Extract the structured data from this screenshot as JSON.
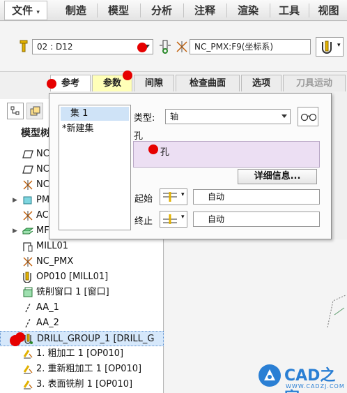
{
  "menu": {
    "items": [
      "文件",
      "制造",
      "模型",
      "分析",
      "注释",
      "渲染",
      "工具",
      "视图"
    ]
  },
  "toolbar": {
    "tool_value": "02 : D12",
    "coord_value": "NC_PMX:F9(坐标系)"
  },
  "tabs": [
    "参考",
    "参数",
    "间隙",
    "检查曲面",
    "选项",
    "刀具运动"
  ],
  "popup": {
    "sets": [
      "集 1",
      "*新建集"
    ],
    "type_label": "类型:",
    "type_value": "轴",
    "hole_label": "孔",
    "hole_item": "孔",
    "details_button": "详细信息...",
    "start_label": "起始",
    "start_value": "自动",
    "end_label": "终止",
    "end_value": "自动"
  },
  "panel": {
    "header_label": "模型树"
  },
  "tree": [
    {
      "label": "NC",
      "icon": "plane-icon"
    },
    {
      "label": "NC",
      "icon": "plane-icon"
    },
    {
      "label": "NC",
      "icon": "csys-icon"
    },
    {
      "label": "PM",
      "icon": "part-icon"
    },
    {
      "label": "AC",
      "icon": "csys-icon"
    },
    {
      "label": "MF",
      "icon": "workpiece-icon"
    },
    {
      "label": "MILL01",
      "icon": "machine-icon"
    },
    {
      "label": "NC_PMX",
      "icon": "csys-icon"
    },
    {
      "label": "OP010 [MILL01]",
      "icon": "operation-icon"
    },
    {
      "label": "铣削窗口 1 [窗口]",
      "icon": "window-icon"
    },
    {
      "label": "AA_1",
      "icon": "axis-icon"
    },
    {
      "label": "AA_2",
      "icon": "axis-icon"
    },
    {
      "label": "DRILL_GROUP_1 [DRILL_G",
      "icon": "drill-group-icon"
    },
    {
      "label": "1. 粗加工 1 [OP010]",
      "icon": "sequence-icon"
    },
    {
      "label": "2. 重新粗加工 1 [OP010]",
      "icon": "sequence-icon"
    },
    {
      "label": "3. 表面铣削 1 [OP010]",
      "icon": "sequence-icon"
    }
  ],
  "watermark": {
    "text": "CAD之家",
    "url": "WWW.CADZJ.COM"
  },
  "colors": {
    "accent_blue": "#cfe3f7",
    "selection": "#d6e8fb",
    "hole_field": "#ecdff3",
    "active_tab": "#ffffb8",
    "marker": "#e60000"
  }
}
